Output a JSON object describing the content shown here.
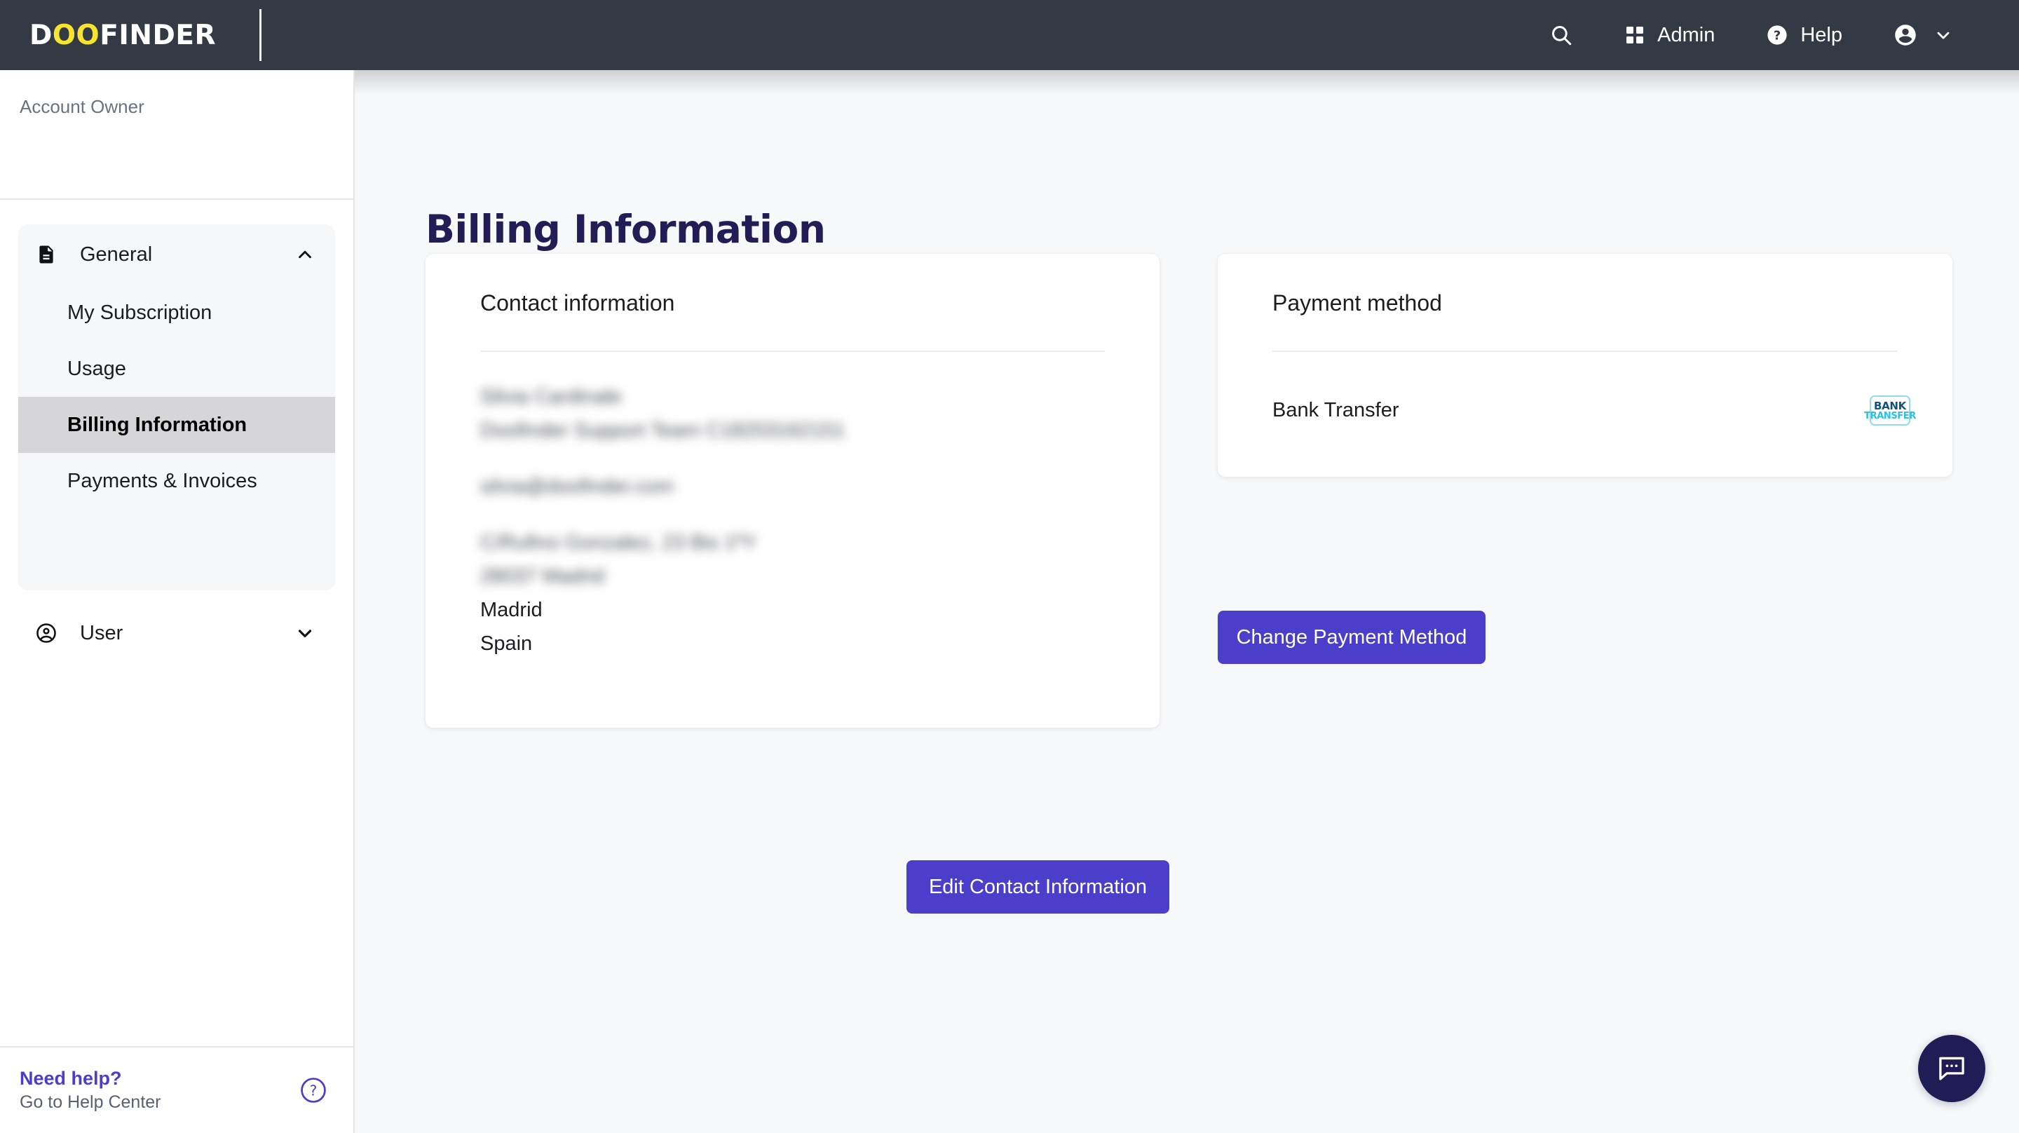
{
  "topbar": {
    "logo": {
      "part1": "D",
      "oo": "OO",
      "part2": "FINDER"
    },
    "items": [
      {
        "icon": "search-icon",
        "label": ""
      },
      {
        "icon": "grid-icon",
        "label": "Admin"
      },
      {
        "icon": "question-circle-icon",
        "label": "Help"
      },
      {
        "icon": "account-circle-icon",
        "label": ""
      }
    ],
    "admin_label": "Admin",
    "help_label": "Help"
  },
  "sidebar": {
    "account_role": "Account Owner",
    "groups": [
      {
        "label": "General",
        "icon": "document-icon",
        "chevron": "chevron-up-icon",
        "expanded": true,
        "items": [
          {
            "label": "My Subscription",
            "active": false
          },
          {
            "label": "Usage",
            "active": false
          },
          {
            "label": "Billing Information",
            "active": true
          },
          {
            "label": "Payments & Invoices",
            "active": false
          }
        ]
      },
      {
        "label": "User",
        "icon": "account-circle-icon",
        "chevron": "chevron-down-icon",
        "expanded": false,
        "items": []
      }
    ],
    "help": {
      "title": "Need help?",
      "subtitle": "Go to Help Center",
      "icon": "question-circle-outline-icon"
    }
  },
  "main": {
    "page_title": "Billing Information",
    "contact_card": {
      "title": "Contact information",
      "lines": [
        {
          "text": "Silvia Cardinale",
          "redacted": true
        },
        {
          "text": "Doofinder Support Team C18203162151",
          "redacted": true
        },
        {
          "text": "",
          "spacer": true
        },
        {
          "text": "silvia@doofinder.com",
          "redacted": true
        },
        {
          "text": "",
          "spacer": true
        },
        {
          "text": "C/Rufino Gonzalez, 23 Bis 1ºY",
          "redacted": true
        },
        {
          "text": "28037 Madrid",
          "redacted": true
        },
        {
          "text": "Madrid",
          "redacted": false
        },
        {
          "text": "Spain",
          "redacted": false
        }
      ],
      "edit_button": "Edit Contact Information"
    },
    "payment_card": {
      "title": "Payment method",
      "method_name": "Bank Transfer",
      "badge": {
        "line1": "BANK",
        "line2": "TRANSFER",
        "icon": "bank-transfer-icon"
      },
      "change_button": "Change Payment Method"
    },
    "chat_fab": {
      "icon": "chat-bubble-icon"
    }
  },
  "colors": {
    "header_bg": "#343a43",
    "logo_accent": "#f6e431",
    "primary": "#4b3ecb",
    "title_navy": "#231c55",
    "content_bg": "#f7f8fa",
    "active_nav": "#d6d6d8",
    "fab": "#201c56",
    "badge_cyan": "#25c1e8",
    "badge_navy": "#14527e"
  }
}
